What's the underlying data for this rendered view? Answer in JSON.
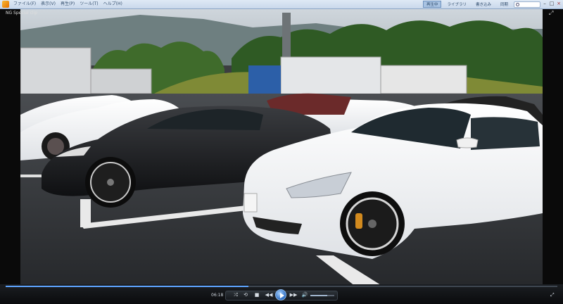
{
  "menubar": {
    "items": [
      "ファイル(F)",
      "表示(V)",
      "再生(P)",
      "ツール(T)",
      "ヘルプ(H)"
    ],
    "tabs": [
      "再生中",
      "ライブラリ",
      "書き込み",
      "同期"
    ],
    "active_tab_index": 0
  },
  "video": {
    "title": "NG Special clip"
  },
  "controls": {
    "timecode": "06:18",
    "seek_progress": 0.44,
    "volume_level": 0.72,
    "icons": {
      "shuffle": "⤮",
      "repeat": "⟲",
      "stop": "■",
      "prev": "◀◀",
      "next": "▶▶",
      "mute": "🔊",
      "fullscreen": "⤢"
    }
  },
  "colors": {
    "accent": "#5ea4ff",
    "menubar": "#dfe9f5"
  }
}
